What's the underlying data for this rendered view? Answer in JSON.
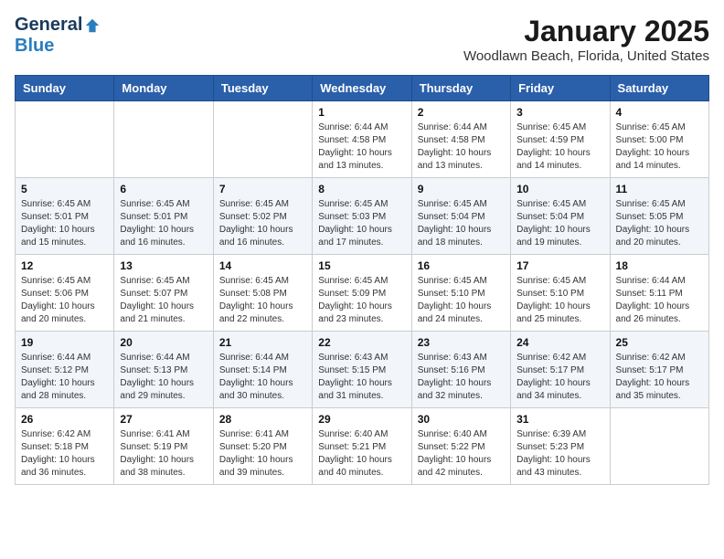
{
  "header": {
    "logo_general": "General",
    "logo_blue": "Blue",
    "month_title": "January 2025",
    "location": "Woodlawn Beach, Florida, United States"
  },
  "weekdays": [
    "Sunday",
    "Monday",
    "Tuesday",
    "Wednesday",
    "Thursday",
    "Friday",
    "Saturday"
  ],
  "weeks": [
    [
      {
        "day": "",
        "info": ""
      },
      {
        "day": "",
        "info": ""
      },
      {
        "day": "",
        "info": ""
      },
      {
        "day": "1",
        "info": "Sunrise: 6:44 AM\nSunset: 4:58 PM\nDaylight: 10 hours\nand 13 minutes."
      },
      {
        "day": "2",
        "info": "Sunrise: 6:44 AM\nSunset: 4:58 PM\nDaylight: 10 hours\nand 13 minutes."
      },
      {
        "day": "3",
        "info": "Sunrise: 6:45 AM\nSunset: 4:59 PM\nDaylight: 10 hours\nand 14 minutes."
      },
      {
        "day": "4",
        "info": "Sunrise: 6:45 AM\nSunset: 5:00 PM\nDaylight: 10 hours\nand 14 minutes."
      }
    ],
    [
      {
        "day": "5",
        "info": "Sunrise: 6:45 AM\nSunset: 5:01 PM\nDaylight: 10 hours\nand 15 minutes."
      },
      {
        "day": "6",
        "info": "Sunrise: 6:45 AM\nSunset: 5:01 PM\nDaylight: 10 hours\nand 16 minutes."
      },
      {
        "day": "7",
        "info": "Sunrise: 6:45 AM\nSunset: 5:02 PM\nDaylight: 10 hours\nand 16 minutes."
      },
      {
        "day": "8",
        "info": "Sunrise: 6:45 AM\nSunset: 5:03 PM\nDaylight: 10 hours\nand 17 minutes."
      },
      {
        "day": "9",
        "info": "Sunrise: 6:45 AM\nSunset: 5:04 PM\nDaylight: 10 hours\nand 18 minutes."
      },
      {
        "day": "10",
        "info": "Sunrise: 6:45 AM\nSunset: 5:04 PM\nDaylight: 10 hours\nand 19 minutes."
      },
      {
        "day": "11",
        "info": "Sunrise: 6:45 AM\nSunset: 5:05 PM\nDaylight: 10 hours\nand 20 minutes."
      }
    ],
    [
      {
        "day": "12",
        "info": "Sunrise: 6:45 AM\nSunset: 5:06 PM\nDaylight: 10 hours\nand 20 minutes."
      },
      {
        "day": "13",
        "info": "Sunrise: 6:45 AM\nSunset: 5:07 PM\nDaylight: 10 hours\nand 21 minutes."
      },
      {
        "day": "14",
        "info": "Sunrise: 6:45 AM\nSunset: 5:08 PM\nDaylight: 10 hours\nand 22 minutes."
      },
      {
        "day": "15",
        "info": "Sunrise: 6:45 AM\nSunset: 5:09 PM\nDaylight: 10 hours\nand 23 minutes."
      },
      {
        "day": "16",
        "info": "Sunrise: 6:45 AM\nSunset: 5:10 PM\nDaylight: 10 hours\nand 24 minutes."
      },
      {
        "day": "17",
        "info": "Sunrise: 6:45 AM\nSunset: 5:10 PM\nDaylight: 10 hours\nand 25 minutes."
      },
      {
        "day": "18",
        "info": "Sunrise: 6:44 AM\nSunset: 5:11 PM\nDaylight: 10 hours\nand 26 minutes."
      }
    ],
    [
      {
        "day": "19",
        "info": "Sunrise: 6:44 AM\nSunset: 5:12 PM\nDaylight: 10 hours\nand 28 minutes."
      },
      {
        "day": "20",
        "info": "Sunrise: 6:44 AM\nSunset: 5:13 PM\nDaylight: 10 hours\nand 29 minutes."
      },
      {
        "day": "21",
        "info": "Sunrise: 6:44 AM\nSunset: 5:14 PM\nDaylight: 10 hours\nand 30 minutes."
      },
      {
        "day": "22",
        "info": "Sunrise: 6:43 AM\nSunset: 5:15 PM\nDaylight: 10 hours\nand 31 minutes."
      },
      {
        "day": "23",
        "info": "Sunrise: 6:43 AM\nSunset: 5:16 PM\nDaylight: 10 hours\nand 32 minutes."
      },
      {
        "day": "24",
        "info": "Sunrise: 6:42 AM\nSunset: 5:17 PM\nDaylight: 10 hours\nand 34 minutes."
      },
      {
        "day": "25",
        "info": "Sunrise: 6:42 AM\nSunset: 5:17 PM\nDaylight: 10 hours\nand 35 minutes."
      }
    ],
    [
      {
        "day": "26",
        "info": "Sunrise: 6:42 AM\nSunset: 5:18 PM\nDaylight: 10 hours\nand 36 minutes."
      },
      {
        "day": "27",
        "info": "Sunrise: 6:41 AM\nSunset: 5:19 PM\nDaylight: 10 hours\nand 38 minutes."
      },
      {
        "day": "28",
        "info": "Sunrise: 6:41 AM\nSunset: 5:20 PM\nDaylight: 10 hours\nand 39 minutes."
      },
      {
        "day": "29",
        "info": "Sunrise: 6:40 AM\nSunset: 5:21 PM\nDaylight: 10 hours\nand 40 minutes."
      },
      {
        "day": "30",
        "info": "Sunrise: 6:40 AM\nSunset: 5:22 PM\nDaylight: 10 hours\nand 42 minutes."
      },
      {
        "day": "31",
        "info": "Sunrise: 6:39 AM\nSunset: 5:23 PM\nDaylight: 10 hours\nand 43 minutes."
      },
      {
        "day": "",
        "info": ""
      }
    ]
  ]
}
